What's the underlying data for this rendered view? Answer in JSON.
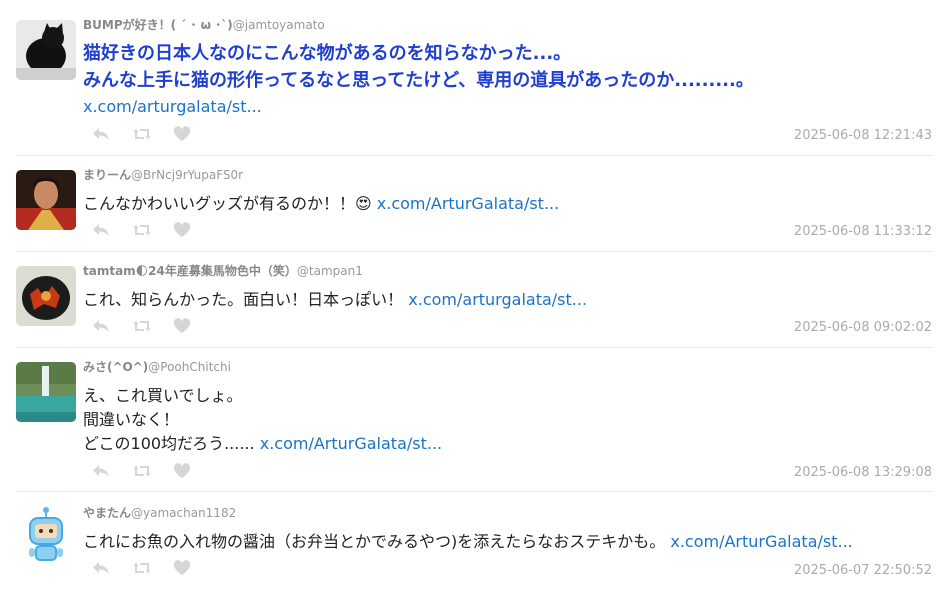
{
  "tweets": [
    {
      "display_name": "BUMPが好き！( ´ ･ ω ･`)",
      "handle": "@jamtoyamato",
      "lines": [
        "猫好きの日本人なのにこんな物があるのを知らなかった...。",
        "みんな上手に猫の形作ってるなと思ってたけど、専用の道具があったのか.........。"
      ],
      "link": "x.com/arturgalata/st...",
      "timestamp": "2025-06-08 12:21:43"
    },
    {
      "display_name": "まりーん",
      "handle": "@BrNcj9rYupaFS0r",
      "text": "こんなかわいいグッズが有るのか！！😍",
      "link": "x.com/ArturGalata/st...",
      "timestamp": "2025-06-08 11:33:12"
    },
    {
      "display_name": "tamtam🌓24年産募集馬物色中（笑）",
      "handle": "@tampan1",
      "text": "これ、知らんかった。面白い！日本っぽい！",
      "link": "x.com/arturgalata/st...",
      "timestamp": "2025-06-08 09:02:02"
    },
    {
      "display_name": "みさ(^O^)",
      "handle": "@PoohChitchi",
      "lines": [
        "え、これ買いでしょ。",
        "間違いなく！",
        "どこの100均だろう......"
      ],
      "link": "x.com/ArturGalata/st...",
      "timestamp": "2025-06-08 13:29:08"
    },
    {
      "display_name": "やまたん",
      "handle": "@yamachan1182",
      "text": "これにお魚の入れ物の醤油（お弁当とかでみるやつ)を添えたらなおステキかも。",
      "link": "x.com/ArturGalata/st...",
      "timestamp": "2025-06-07 22:50:52"
    }
  ],
  "icons": [
    "reply-icon",
    "retweet-icon",
    "like-icon"
  ],
  "colors": {
    "link": "#1a73c8",
    "highlight_text": "#1f3fcf",
    "meta": "#aaaaaa",
    "icon": "#d6d6d6"
  }
}
